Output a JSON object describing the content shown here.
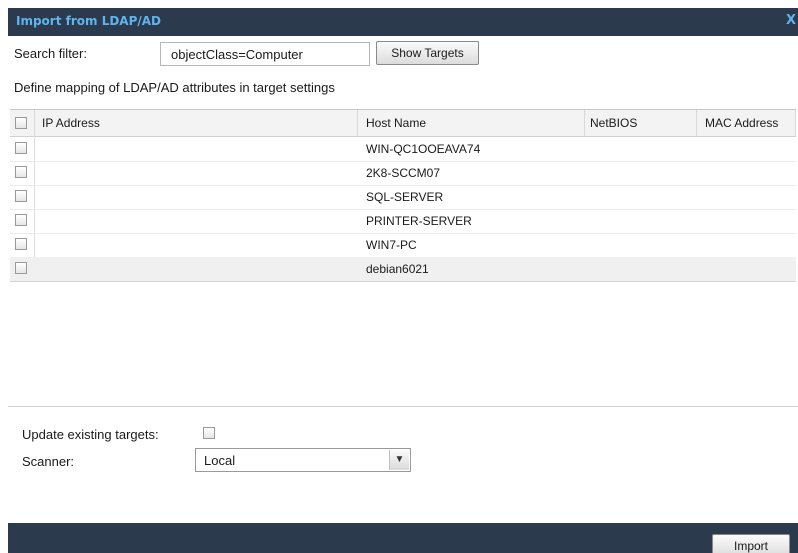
{
  "dialog": {
    "title": "Import from LDAP/AD",
    "close_glyph": "X"
  },
  "search": {
    "label": "Search filter:",
    "value": "objectClass=Computer",
    "button": "Show Targets"
  },
  "hint": "Define mapping of LDAP/AD attributes in target settings",
  "grid": {
    "columns": [
      "IP Address",
      "Host Name",
      "NetBIOS",
      "MAC Address"
    ],
    "rows": [
      {
        "ip": "",
        "host": "WIN-QC1OOEAVA74",
        "netbios": "",
        "mac": "",
        "checked": false
      },
      {
        "ip": "",
        "host": "2K8-SCCM07",
        "netbios": "",
        "mac": "",
        "checked": false
      },
      {
        "ip": "",
        "host": "SQL-SERVER",
        "netbios": "",
        "mac": "",
        "checked": false
      },
      {
        "ip": "",
        "host": "PRINTER-SERVER",
        "netbios": "",
        "mac": "",
        "checked": false
      },
      {
        "ip": "",
        "host": "WIN7-PC",
        "netbios": "",
        "mac": "",
        "checked": false
      },
      {
        "ip": "",
        "host": "debian6021",
        "netbios": "",
        "mac": "",
        "checked": false
      }
    ],
    "selected_row": 5
  },
  "options": {
    "update_label": "Update existing targets:",
    "update_checked": false,
    "scanner_label": "Scanner:",
    "scanner_value": "Local"
  },
  "footer": {
    "import_button": "Import"
  },
  "colors": {
    "titlebar": "#2b3a4d",
    "title_text": "#5fb4ee",
    "selected_row": "#f0f0f0"
  }
}
